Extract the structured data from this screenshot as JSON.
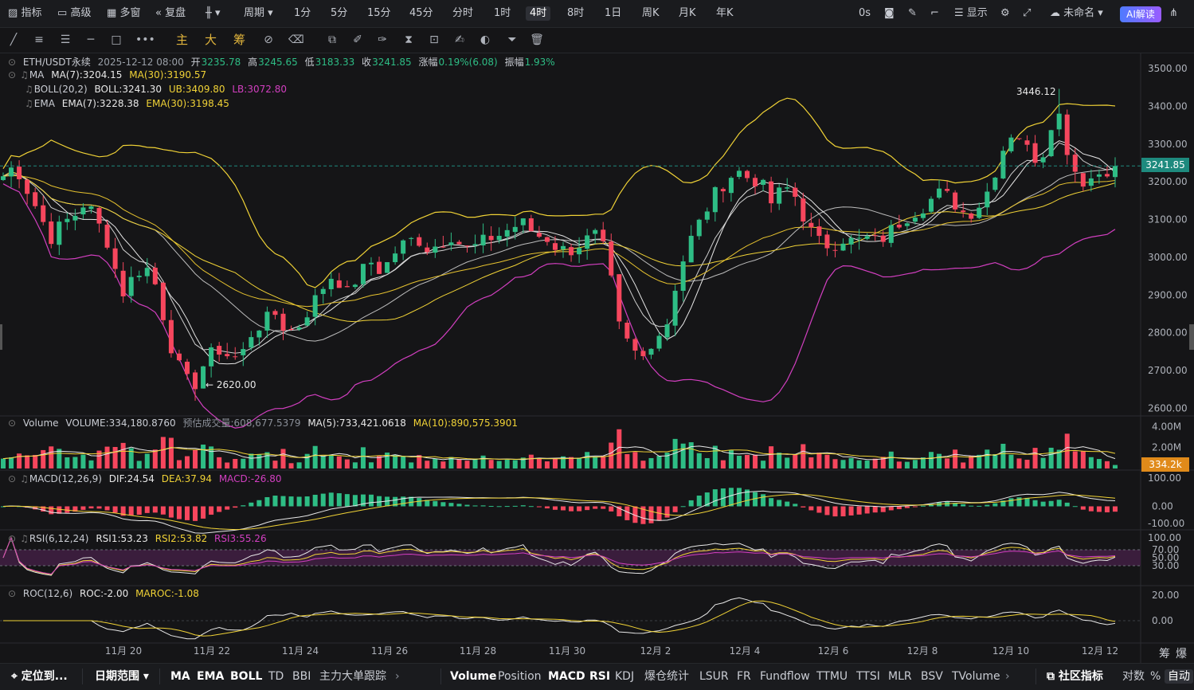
{
  "toolbar": {
    "indicators": "指标",
    "advanced": "高级",
    "multi_window": "多窗",
    "replay": "复盘",
    "period": "周期",
    "intervals": [
      "1分",
      "5分",
      "15分",
      "45分",
      "分时",
      "1时",
      "4时",
      "8时",
      "1日",
      "周K",
      "月K",
      "年K"
    ],
    "active_interval": "4时",
    "countdown": "0s",
    "display": "显示",
    "layout_name": "未命名",
    "ai_label": "AI解读"
  },
  "drawbar": {
    "main": "主",
    "big": "大",
    "chips": "筹"
  },
  "legend": {
    "symbol": "ETH/USDT永续",
    "datetime": "2025-12-12 08:00",
    "open_label": "开",
    "open": "3235.78",
    "high_label": "高",
    "high": "3245.65",
    "low_label": "低",
    "low": "3183.33",
    "close_label": "收",
    "close": "3241.85",
    "change_label": "涨幅",
    "change": "0.19%(6.08)",
    "amp_label": "振幅",
    "amp": "1.93%",
    "ma_label": "MA",
    "ma7": "MA(7):3204.15",
    "ma30": "MA(30):3190.57",
    "boll_label": "BOLL(20,2)",
    "boll": "BOLL:3241.30",
    "ub": "UB:3409.80",
    "lb": "LB:3072.80",
    "ema_label": "EMA",
    "ema7": "EMA(7):3228.38",
    "ema30": "EMA(30):3198.45",
    "volume_label": "Volume",
    "volume": "VOLUME:334,180.8760",
    "est_volume": "预估成交量:608,677.5379",
    "vma5": "MA(5):733,421.0618",
    "vma10": "MA(10):890,575.3901",
    "macd_label": "MACD(12,26,9)",
    "dif": "DIF:24.54",
    "dea": "DEA:37.94",
    "macd": "MACD:-26.80",
    "rsi_label": "RSI(6,12,24)",
    "rsi1": "RSI1:53.23",
    "rsi2": "RSI2:53.82",
    "rsi3": "RSI3:55.26",
    "roc_label": "ROC(12,6)",
    "roc": "ROC:-2.00",
    "maroc": "MAROC:-1.08"
  },
  "price_axis": [
    "3500.00",
    "3400.00",
    "3300.00",
    "3200.00",
    "3100.00",
    "3000.00",
    "2900.00",
    "2800.00",
    "2700.00",
    "2600.00"
  ],
  "current_price": "3241.85",
  "high_marker": "3446.12",
  "low_marker": "← 2620.00",
  "volume_axis": [
    "4.00M",
    "2.00M"
  ],
  "current_volume": "334.2k",
  "macd_axis": [
    "100.00",
    "0.00",
    "-100.00"
  ],
  "rsi_axis": [
    "100.00",
    "70.00",
    "50.00",
    "30.00"
  ],
  "roc_axis": [
    "20.00",
    "0.00"
  ],
  "dates": [
    "11月 20",
    "11月 22",
    "11月 24",
    "11月 26",
    "11月 28",
    "11月 30",
    "12月 2",
    "12月 4",
    "12月 6",
    "12月 8",
    "12月 10",
    "12月 12"
  ],
  "corner": {
    "chips": "筹",
    "burst": "爆"
  },
  "bottom": {
    "locate": "定位到...",
    "date_range": "日期范围",
    "main_indicators": [
      "MA",
      "EMA",
      "BOLL",
      "TD",
      "BBI",
      "主力大单跟踪"
    ],
    "sub_indicators": [
      "Volume",
      "Position",
      "MACD",
      "RSI",
      "KDJ",
      "爆仓统计",
      "LSUR",
      "FR",
      "Fundflow",
      "TTMU",
      "TTSI",
      "MLR",
      "BSV",
      "TVolume"
    ],
    "community": "社区指标",
    "log": "对数",
    "percent": "%",
    "auto": "自动"
  },
  "colors": {
    "up": "#2ebd85",
    "down": "#f6465d",
    "ma7": "#e8e8e8",
    "ma30": "#f0d236",
    "boll_lb": "#d23fc0",
    "accent": "#1e8a7e",
    "volume_tag": "#e08a1a"
  },
  "chart_data": {
    "type": "candlestick",
    "interval": "4h",
    "x_range": [
      "11月 19",
      "12月 12"
    ],
    "y_range": [
      2580,
      3540
    ],
    "close_path": [
      3215,
      3245,
      3180,
      3120,
      3050,
      3090,
      3110,
      3150,
      3090,
      3030,
      2900,
      2950,
      2980,
      2920,
      2780,
      2700,
      2650,
      2720,
      2760,
      2740,
      2730,
      2800,
      2830,
      2850,
      2800,
      2820,
      2870,
      2920,
      2960,
      2900,
      2950,
      2990,
      2960,
      3010,
      3040,
      3050,
      3020,
      3040,
      3060,
      3020,
      3030,
      3050,
      3060,
      3080,
      3090,
      3060,
      3050,
      3020,
      3020,
      3040,
      3060,
      3010,
      2820,
      2760,
      2730,
      2790,
      2810,
      2950,
      3040,
      3100,
      3160,
      3200,
      3230,
      3210,
      3200,
      3140,
      3190,
      3160,
      3080,
      3040,
      3030,
      3050,
      3040,
      3050,
      3040,
      3070,
      3100,
      3120,
      3140,
      3170,
      3160,
      3120,
      3120,
      3160,
      3240,
      3330,
      3320,
      3260,
      3280,
      3410,
      3280,
      3200,
      3210,
      3230,
      3241.85
    ]
  }
}
